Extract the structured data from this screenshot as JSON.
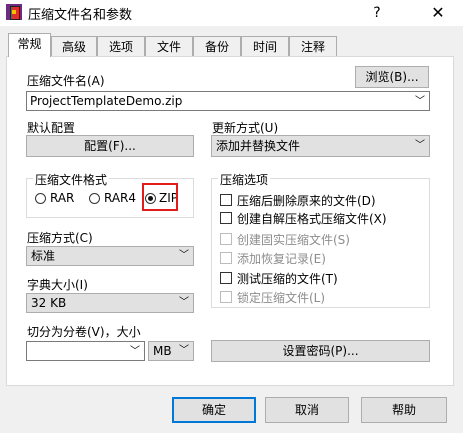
{
  "window": {
    "title": "压缩文件名和参数",
    "help": "?",
    "close": "✕"
  },
  "tabs": [
    "常规",
    "高级",
    "选项",
    "文件",
    "备份",
    "时间",
    "注释"
  ],
  "archive": {
    "label": "压缩文件名(A)",
    "browse": "浏览(B)...",
    "filename": "ProjectTemplateDemo.zip"
  },
  "profile": {
    "label": "默认配置",
    "button": "配置(F)..."
  },
  "update": {
    "label": "更新方式(U)",
    "value": "添加并替换文件"
  },
  "format": {
    "label": "压缩文件格式",
    "options": [
      "RAR",
      "RAR4",
      "ZIP"
    ],
    "selected": "ZIP"
  },
  "method": {
    "label": "压缩方式(C)",
    "value": "标准"
  },
  "dict": {
    "label": "字典大小(I)",
    "value": "32 KB"
  },
  "split": {
    "label": "切分为分卷(V)，大小",
    "value": "",
    "unit": "MB"
  },
  "options": {
    "label": "压缩选项",
    "items": [
      {
        "text": "压缩后删除原来的文件(D)",
        "enabled": true
      },
      {
        "text": "创建自解压格式压缩文件(X)",
        "enabled": true
      },
      {
        "text": "创建固实压缩文件(S)",
        "enabled": false
      },
      {
        "text": "添加恢复记录(E)",
        "enabled": false
      },
      {
        "text": "测试压缩的文件(T)",
        "enabled": true
      },
      {
        "text": "锁定压缩文件(L)",
        "enabled": false
      }
    ]
  },
  "password": {
    "button": "设置密码(P)..."
  },
  "buttons": {
    "ok": "确定",
    "cancel": "取消",
    "help": "帮助"
  }
}
